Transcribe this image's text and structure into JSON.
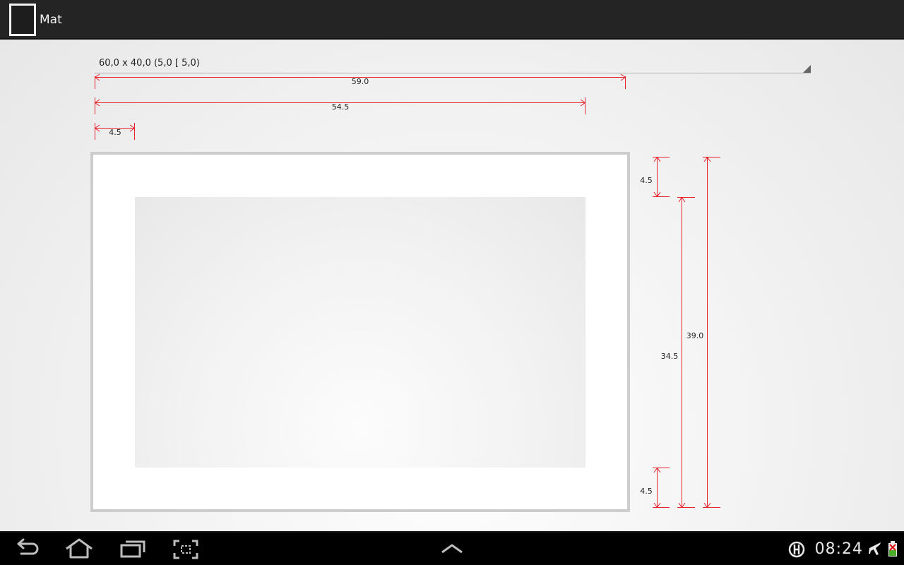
{
  "app": {
    "title": "Mat",
    "icon": "mat-frame-icon"
  },
  "selector": {
    "value": "60,0 x 40,0 (5,0 [ 5,0)"
  },
  "dimensions": {
    "outer_width": "59.0",
    "opening_right": "54.5",
    "left_margin": "4.5",
    "top_margin": "4.5",
    "opening_bottom": "34.5",
    "outer_height": "39.0",
    "bottom_margin": "4.5"
  },
  "colors": {
    "dimension_line": "#e8202a",
    "action_bar": "#242424",
    "nav_bar": "#000000"
  },
  "status": {
    "time": "08:24",
    "icons": [
      "sync-icon",
      "airplane-mode-icon",
      "battery-icon"
    ]
  },
  "nav": {
    "buttons": [
      "back-icon",
      "home-icon",
      "recent-apps-icon",
      "screenshot-icon",
      "up-chevron-icon"
    ]
  }
}
